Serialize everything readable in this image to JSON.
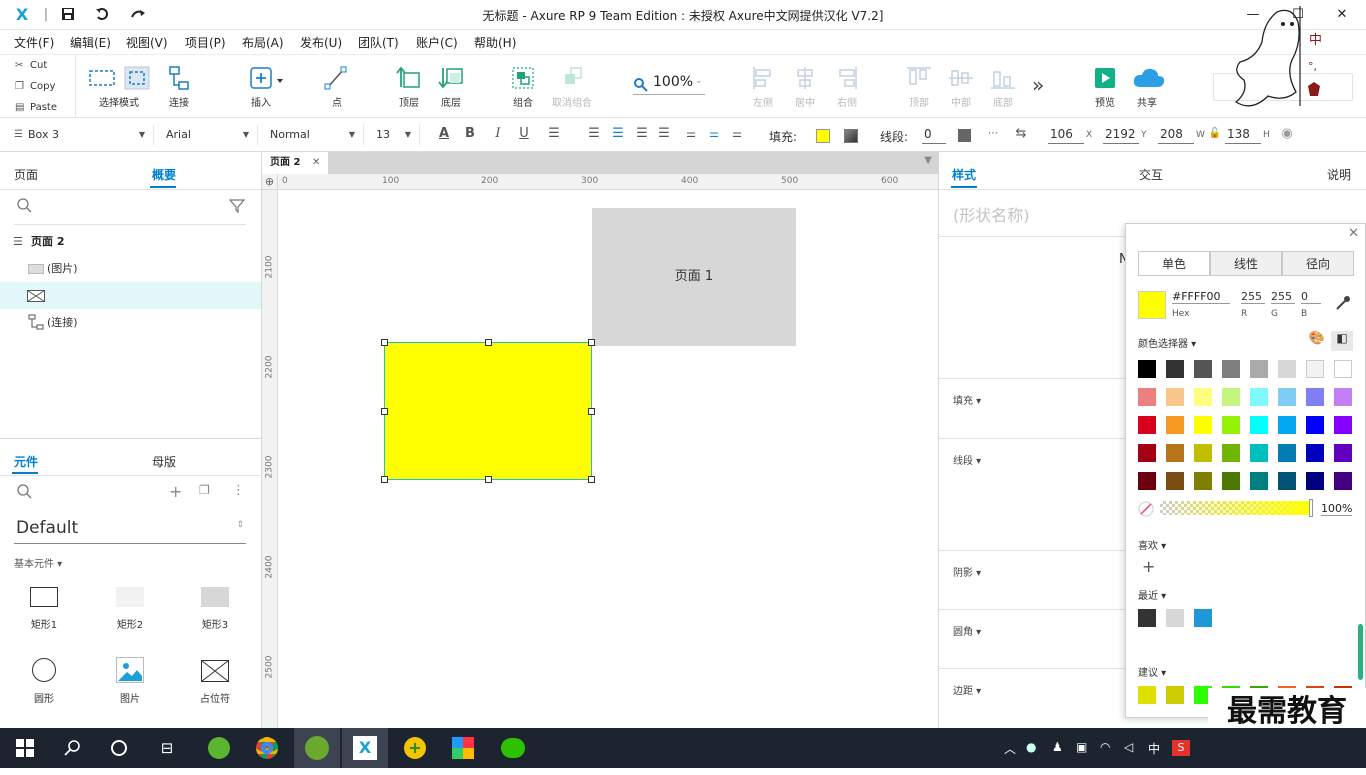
{
  "titlebar": {
    "title": "无标题 - Axure RP 9 Team Edition : 未授权    Axure中文网提供汉化 V7.2]",
    "logo": "X",
    "sep": "|",
    "minimize": "—",
    "maximize": "☐",
    "close": "✕"
  },
  "menu": [
    "文件(F)",
    "编辑(E)",
    "视图(V)",
    "项目(P)",
    "布局(A)",
    "发布(U)",
    "团队(T)",
    "账户(C)",
    "帮助(H)"
  ],
  "clipboard": {
    "cut": "Cut",
    "copy": "Copy",
    "paste": "Paste"
  },
  "toolbar": {
    "select_mode": "选择模式",
    "connect": "连接",
    "insert": "插入",
    "point": "点",
    "top_layer": "顶层",
    "bottom_layer": "底层",
    "group": "组合",
    "ungroup": "取消组合",
    "zoom": "100%",
    "align_left": "左侧",
    "align_center": "居中",
    "align_right": "右侧",
    "align_top": "顶部",
    "align_middle": "中部",
    "align_bottom": "底部",
    "more": "»",
    "preview": "预览",
    "share": "共享"
  },
  "formatbar": {
    "style": "Box 3",
    "font": "Arial",
    "weight": "Normal",
    "size": "13",
    "fill_label": "填充:",
    "fill_color": "#FFFF00",
    "stroke_label": "线段:",
    "stroke_width": "0",
    "x": "106",
    "x_unit": "X",
    "y": "2192",
    "y_unit": "Y",
    "w": "208",
    "w_unit": "W",
    "h": "138",
    "h_unit": "H"
  },
  "leftpanel": {
    "tabs": [
      "页面",
      "概要"
    ],
    "outline": {
      "page": "页面 2",
      "items": [
        "(图片)",
        "",
        "(连接)"
      ]
    },
    "lib_tabs": [
      "元件",
      "母版"
    ],
    "library": "Default",
    "category": "基本元件",
    "widgets": [
      "矩形1",
      "矩形2",
      "矩形3",
      "圆形",
      "图片",
      "占位符"
    ]
  },
  "canvas": {
    "tab": "页面 2",
    "ruler_top": [
      "0",
      "100",
      "200",
      "300",
      "400",
      "500",
      "600"
    ],
    "ruler_left": [
      "2100",
      "2200",
      "2300",
      "2400",
      "2500"
    ],
    "box_label": "页面 1",
    "yellow": "#FFFF00",
    "gray": "#D7D7D7"
  },
  "rightpanel": {
    "tabs": [
      "样式",
      "交互",
      "说明"
    ],
    "shape_name_placeholder": "(形状名称)",
    "sections": [
      "填充",
      "线段",
      "阴影",
      "圆角",
      "边距"
    ],
    "partial": "N"
  },
  "picker": {
    "tabs": [
      "单色",
      "线性",
      "径向"
    ],
    "hex": "#FFFF00",
    "hex_label": "Hex",
    "r": "255",
    "g": "255",
    "b": "0",
    "r_label": "R",
    "g_label": "G",
    "b_label": "B",
    "picker_label": "颜色选择器",
    "opacity": "100%",
    "favorites_label": "喜欢",
    "add": "+",
    "recent_label": "最近",
    "suggest_label": "建议",
    "palette": [
      [
        "#000000",
        "#333333",
        "#555555",
        "#7f7f7f",
        "#aaaaaa",
        "#d7d7d7",
        "#f2f2f2",
        "#ffffff"
      ],
      [
        "#ee7f7f",
        "#f9c78c",
        "#fdfd7f",
        "#c4f57f",
        "#7ff9f9",
        "#7fccf5",
        "#807ff5",
        "#c47ff5"
      ],
      [
        "#d9001b",
        "#f59a23",
        "#ffff00",
        "#95f204",
        "#00ffff",
        "#02a7f0",
        "#0000ff",
        "#8400ff"
      ],
      [
        "#a30014",
        "#b8741a",
        "#bfbf00",
        "#70b603",
        "#00bfbf",
        "#027db4",
        "#0000bf",
        "#6300bf"
      ],
      [
        "#6d000e",
        "#7b4d12",
        "#808000",
        "#4b7902",
        "#008080",
        "#015478",
        "#000080",
        "#420080"
      ]
    ],
    "recent": [
      "#333333",
      "#d7d7d7",
      "#1e98d7"
    ],
    "suggested": [
      "#dfdf00",
      "#cccc00",
      "#2cff00",
      "#33dd00",
      "#33aa00",
      "#ee6622",
      "#dd4411",
      "#cc3300"
    ]
  },
  "watermark": "最需教育",
  "taskbar": {
    "ime": "中"
  }
}
